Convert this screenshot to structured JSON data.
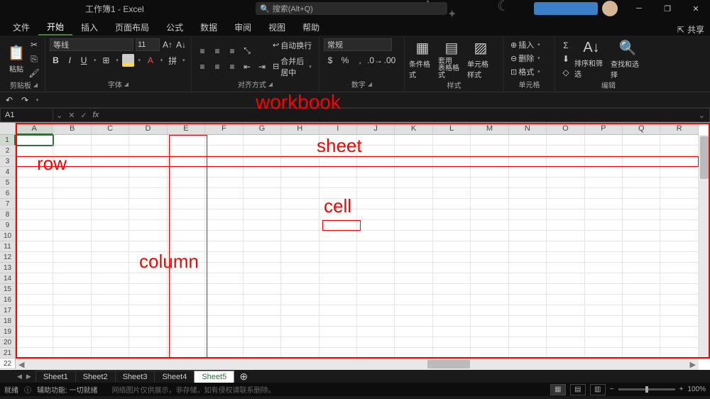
{
  "title": "工作簿1 - Excel",
  "search_placeholder": "搜索(Alt+Q)",
  "menu": {
    "file": "文件",
    "home": "开始",
    "insert": "插入",
    "page_layout": "页面布局",
    "formulas": "公式",
    "data": "数据",
    "review": "审阅",
    "view": "视图",
    "help": "帮助"
  },
  "share": "共享",
  "ribbon": {
    "clipboard": {
      "label": "剪贴板",
      "paste": "粘贴"
    },
    "font": {
      "label": "字体",
      "name": "等线",
      "size": "11",
      "bold": "B",
      "italic": "I",
      "underline": "U"
    },
    "alignment": {
      "label": "对齐方式",
      "wrap": "自动换行",
      "merge": "合并后居中"
    },
    "number": {
      "label": "数字",
      "format": "常规"
    },
    "styles": {
      "label": "样式",
      "conditional": "条件格式",
      "table": "套用\n表格格式",
      "cell": "单元格样式"
    },
    "cells": {
      "label": "单元格",
      "insert": "插入",
      "delete": "删除",
      "format": "格式"
    },
    "editing": {
      "label": "编辑",
      "sort": "排序和筛选",
      "find": "查找和选择"
    }
  },
  "namebox": "A1",
  "columns": [
    "A",
    "B",
    "C",
    "D",
    "E",
    "F",
    "G",
    "H",
    "I",
    "J",
    "K",
    "L",
    "M",
    "N",
    "O",
    "P",
    "Q",
    "R"
  ],
  "rows": [
    "1",
    "2",
    "3",
    "4",
    "5",
    "6",
    "7",
    "8",
    "9",
    "10",
    "11",
    "12",
    "13",
    "14",
    "15",
    "16",
    "17",
    "18",
    "19",
    "20",
    "21",
    "22"
  ],
  "sheets": [
    "Sheet1",
    "Sheet2",
    "Sheet3",
    "Sheet4",
    "Sheet5"
  ],
  "active_sheet": 4,
  "status": {
    "ready": "就绪",
    "accessibility": "辅助功能: 一切就绪",
    "watermark": "网络图片仅供展示，非存储，如有侵权请联系删除。",
    "zoom": "100%"
  },
  "annotations": {
    "workbook": "workbook",
    "sheet": "sheet",
    "row": "row",
    "column": "column",
    "cell": "cell"
  },
  "colors": {
    "accent": "#346f3a",
    "anno": "#ff0000"
  }
}
